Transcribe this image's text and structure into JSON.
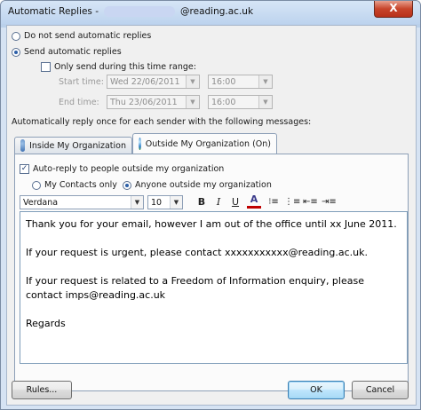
{
  "window": {
    "title_prefix": "Automatic Replies -",
    "title_suffix": "@reading.ac.uk",
    "close_glyph": "X"
  },
  "options": {
    "do_not_send": "Do not send automatic replies",
    "send": "Send automatic replies",
    "time_range": "Only send during this time range:",
    "start_label": "Start time:",
    "end_label": "End time:",
    "start_date": "Wed 22/06/2011",
    "start_time": "16:00",
    "end_date": "Thu 23/06/2011",
    "end_time": "16:00",
    "reply_once": "Automatically reply once for each sender with the following messages:"
  },
  "tabs": {
    "inside": "Inside My Organization",
    "outside": "Outside My Organization (On)"
  },
  "outside_panel": {
    "auto_reply": "Auto-reply to people outside my organization",
    "my_contacts": "My Contacts only",
    "anyone": "Anyone outside my organization"
  },
  "format": {
    "font": "Verdana",
    "size": "10",
    "bold": "B",
    "italic": "I",
    "underline": "U",
    "color": "A"
  },
  "message": [
    "Thank you for your email, however I am out of the office until xx June 2011.",
    "If your request is urgent, please contact xxxxxxxxxxx@reading.ac.uk.",
    "If your request is related to a Freedom of Information enquiry, please contact imps@reading.ac.uk",
    "Regards"
  ],
  "buttons": {
    "rules": "Rules...",
    "ok": "OK",
    "cancel": "Cancel"
  },
  "colors": {
    "accent": "#2c5fa8",
    "font_color_bar": "#c00000"
  }
}
